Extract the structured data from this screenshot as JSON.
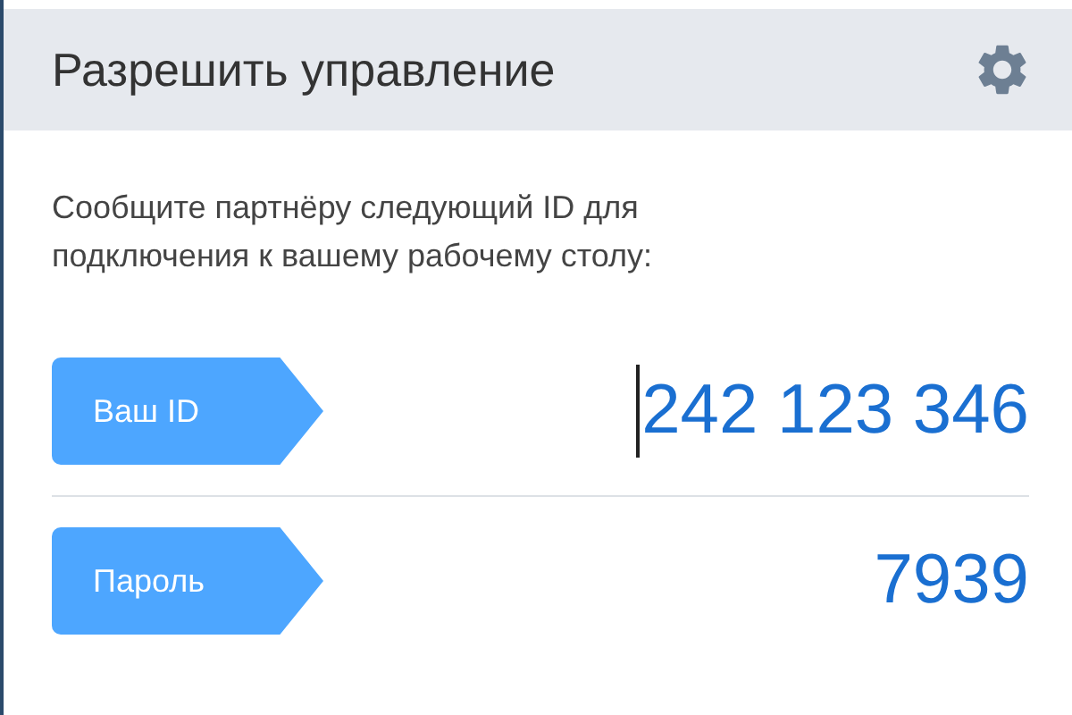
{
  "header": {
    "title": "Разрешить управление"
  },
  "instructions": "Сообщите партнёру следующий ID для подключения к вашему рабочему столу:",
  "fields": [
    {
      "label": "Ваш ID",
      "value": "242 123 346",
      "focused": true
    },
    {
      "label": "Пароль",
      "value": "7939",
      "focused": false
    }
  ]
}
